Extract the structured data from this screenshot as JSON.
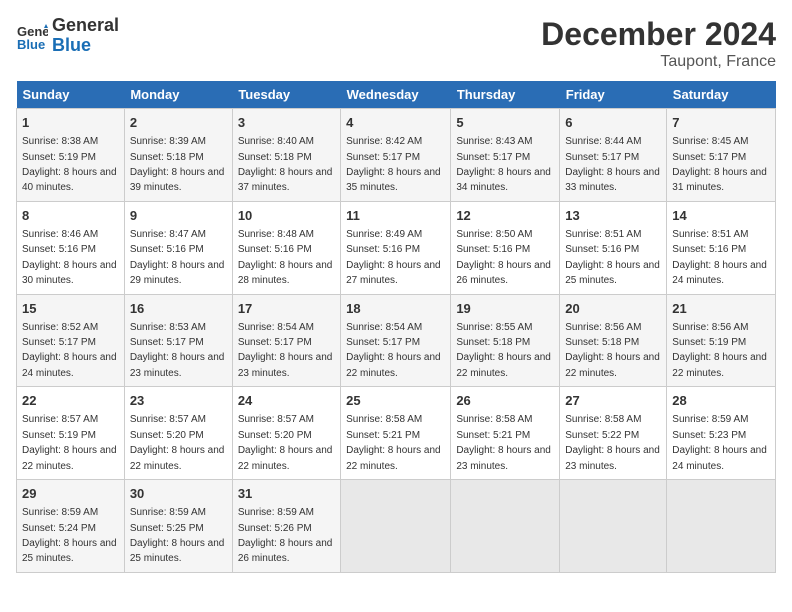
{
  "header": {
    "logo_line1": "General",
    "logo_line2": "Blue",
    "month": "December 2024",
    "location": "Taupont, France"
  },
  "days_of_week": [
    "Sunday",
    "Monday",
    "Tuesday",
    "Wednesday",
    "Thursday",
    "Friday",
    "Saturday"
  ],
  "weeks": [
    [
      {
        "num": "1",
        "sunrise": "8:38 AM",
        "sunset": "5:19 PM",
        "daylight": "8 hours and 40 minutes."
      },
      {
        "num": "2",
        "sunrise": "8:39 AM",
        "sunset": "5:18 PM",
        "daylight": "8 hours and 39 minutes."
      },
      {
        "num": "3",
        "sunrise": "8:40 AM",
        "sunset": "5:18 PM",
        "daylight": "8 hours and 37 minutes."
      },
      {
        "num": "4",
        "sunrise": "8:42 AM",
        "sunset": "5:17 PM",
        "daylight": "8 hours and 35 minutes."
      },
      {
        "num": "5",
        "sunrise": "8:43 AM",
        "sunset": "5:17 PM",
        "daylight": "8 hours and 34 minutes."
      },
      {
        "num": "6",
        "sunrise": "8:44 AM",
        "sunset": "5:17 PM",
        "daylight": "8 hours and 33 minutes."
      },
      {
        "num": "7",
        "sunrise": "8:45 AM",
        "sunset": "5:17 PM",
        "daylight": "8 hours and 31 minutes."
      }
    ],
    [
      {
        "num": "8",
        "sunrise": "8:46 AM",
        "sunset": "5:16 PM",
        "daylight": "8 hours and 30 minutes."
      },
      {
        "num": "9",
        "sunrise": "8:47 AM",
        "sunset": "5:16 PM",
        "daylight": "8 hours and 29 minutes."
      },
      {
        "num": "10",
        "sunrise": "8:48 AM",
        "sunset": "5:16 PM",
        "daylight": "8 hours and 28 minutes."
      },
      {
        "num": "11",
        "sunrise": "8:49 AM",
        "sunset": "5:16 PM",
        "daylight": "8 hours and 27 minutes."
      },
      {
        "num": "12",
        "sunrise": "8:50 AM",
        "sunset": "5:16 PM",
        "daylight": "8 hours and 26 minutes."
      },
      {
        "num": "13",
        "sunrise": "8:51 AM",
        "sunset": "5:16 PM",
        "daylight": "8 hours and 25 minutes."
      },
      {
        "num": "14",
        "sunrise": "8:51 AM",
        "sunset": "5:16 PM",
        "daylight": "8 hours and 24 minutes."
      }
    ],
    [
      {
        "num": "15",
        "sunrise": "8:52 AM",
        "sunset": "5:17 PM",
        "daylight": "8 hours and 24 minutes."
      },
      {
        "num": "16",
        "sunrise": "8:53 AM",
        "sunset": "5:17 PM",
        "daylight": "8 hours and 23 minutes."
      },
      {
        "num": "17",
        "sunrise": "8:54 AM",
        "sunset": "5:17 PM",
        "daylight": "8 hours and 23 minutes."
      },
      {
        "num": "18",
        "sunrise": "8:54 AM",
        "sunset": "5:17 PM",
        "daylight": "8 hours and 22 minutes."
      },
      {
        "num": "19",
        "sunrise": "8:55 AM",
        "sunset": "5:18 PM",
        "daylight": "8 hours and 22 minutes."
      },
      {
        "num": "20",
        "sunrise": "8:56 AM",
        "sunset": "5:18 PM",
        "daylight": "8 hours and 22 minutes."
      },
      {
        "num": "21",
        "sunrise": "8:56 AM",
        "sunset": "5:19 PM",
        "daylight": "8 hours and 22 minutes."
      }
    ],
    [
      {
        "num": "22",
        "sunrise": "8:57 AM",
        "sunset": "5:19 PM",
        "daylight": "8 hours and 22 minutes."
      },
      {
        "num": "23",
        "sunrise": "8:57 AM",
        "sunset": "5:20 PM",
        "daylight": "8 hours and 22 minutes."
      },
      {
        "num": "24",
        "sunrise": "8:57 AM",
        "sunset": "5:20 PM",
        "daylight": "8 hours and 22 minutes."
      },
      {
        "num": "25",
        "sunrise": "8:58 AM",
        "sunset": "5:21 PM",
        "daylight": "8 hours and 22 minutes."
      },
      {
        "num": "26",
        "sunrise": "8:58 AM",
        "sunset": "5:21 PM",
        "daylight": "8 hours and 23 minutes."
      },
      {
        "num": "27",
        "sunrise": "8:58 AM",
        "sunset": "5:22 PM",
        "daylight": "8 hours and 23 minutes."
      },
      {
        "num": "28",
        "sunrise": "8:59 AM",
        "sunset": "5:23 PM",
        "daylight": "8 hours and 24 minutes."
      }
    ],
    [
      {
        "num": "29",
        "sunrise": "8:59 AM",
        "sunset": "5:24 PM",
        "daylight": "8 hours and 25 minutes."
      },
      {
        "num": "30",
        "sunrise": "8:59 AM",
        "sunset": "5:25 PM",
        "daylight": "8 hours and 25 minutes."
      },
      {
        "num": "31",
        "sunrise": "8:59 AM",
        "sunset": "5:26 PM",
        "daylight": "8 hours and 26 minutes."
      },
      null,
      null,
      null,
      null
    ]
  ]
}
